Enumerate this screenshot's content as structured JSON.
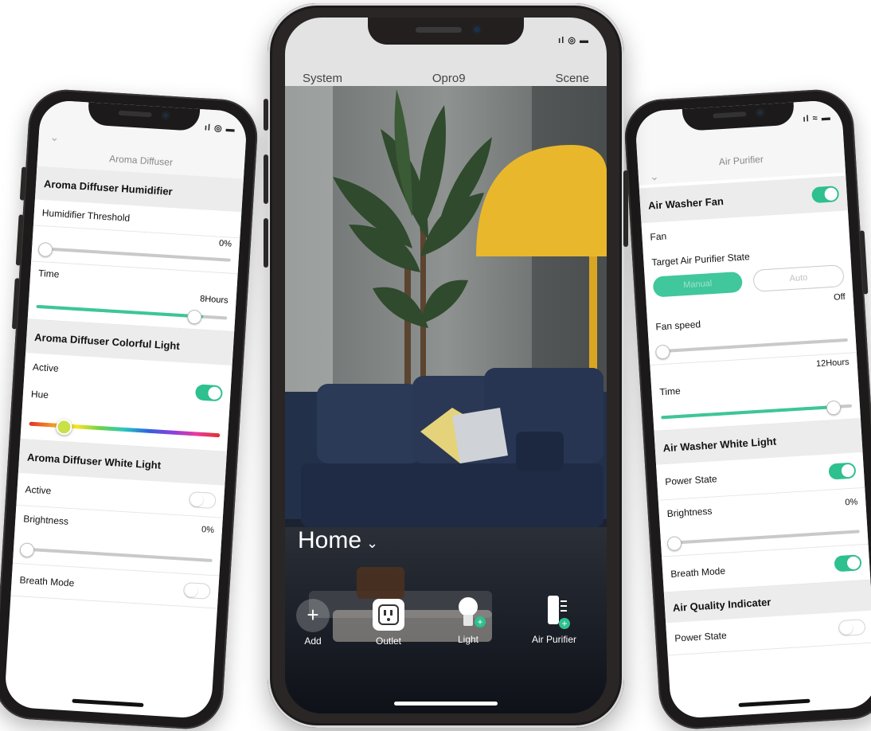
{
  "left_phone": {
    "status_icons": "ıl ◎ ▬",
    "chevron": "⌄",
    "title": "Aroma Diffuser",
    "sections": {
      "humidifier": "Aroma Diffuser Humidifier",
      "threshold_label": "Humidifier Threshold",
      "threshold_value": "0%",
      "threshold_level": 0,
      "time_label": "Time",
      "time_value": "8Hours",
      "time_level": 0.88,
      "colorful": "Aroma Diffuser Colorful Light",
      "active_label": "Active",
      "active_on": true,
      "hue_label": "Hue",
      "hue_level": 0.22,
      "white": "Aroma Diffuser White Light",
      "white_active_label": "Active",
      "white_active_on": false,
      "brightness_label": "Brightness",
      "brightness_value": "0%",
      "brightness_level": 0,
      "breath_label": "Breath Mode",
      "breath_on": false
    }
  },
  "center_phone": {
    "status_icons": "ıl ◎ ▬",
    "nav": {
      "left": "System",
      "title": "Opro9",
      "right": "Scene"
    },
    "home_label": "Home",
    "home_chevron": "⌄",
    "devices": [
      {
        "label": "Add",
        "icon": "plus-icon"
      },
      {
        "label": "Outlet",
        "icon": "outlet-icon"
      },
      {
        "label": "Light",
        "icon": "bulb-icon"
      },
      {
        "label": "Air Purifier",
        "icon": "air-purifier-icon"
      }
    ]
  },
  "right_phone": {
    "status_icons": "ıl ≈ ▬",
    "chevron": "⌄",
    "title": "Air Purifier",
    "sections": {
      "fan_head": "Air Washer Fan",
      "fan_on": true,
      "fan_label": "Fan",
      "target_label": "Target Air Purifier State",
      "seg_manual": "Manual",
      "seg_auto": "Auto",
      "off_value": "Off",
      "fan_speed_label": "Fan speed",
      "fan_speed_level": 0,
      "time_value": "12Hours",
      "time_label": "Time",
      "time_level": 0.9,
      "white_head": "Air Washer White Light",
      "power_label": "Power State",
      "power_on": true,
      "brightness_value": "0%",
      "brightness_label": "Brightness",
      "brightness_level": 0,
      "breath_label": "Breath Mode",
      "breath_on": true,
      "aqi_head": "Air Quality Indicater",
      "aqi_power_label": "Power State",
      "aqi_power_on": false
    }
  },
  "colors": {
    "accent_green": "#2ec08f",
    "phone_body": "#1c1a1a",
    "lamp_yellow": "#e8b72c",
    "sofa_navy": "#25344e"
  }
}
